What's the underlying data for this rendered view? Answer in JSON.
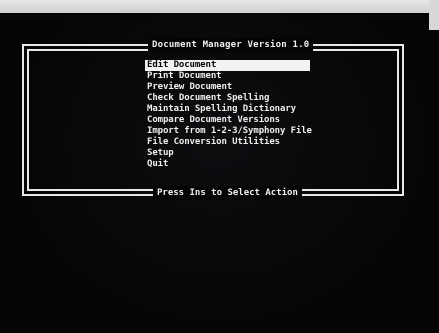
{
  "window": {
    "title": "Document Manager Version 1.0",
    "footer": "Press Ins to Select Action"
  },
  "menu": {
    "selected_index": 0,
    "items": [
      {
        "label": "Edit Document"
      },
      {
        "label": "Print Document"
      },
      {
        "label": "Preview Document"
      },
      {
        "label": "Check Document Spelling"
      },
      {
        "label": "Maintain Spelling Dictionary"
      },
      {
        "label": "Compare Document Versions"
      },
      {
        "label": "Import from 1-2-3/Symphony File"
      },
      {
        "label": "File Conversion Utilities"
      },
      {
        "label": "Setup"
      },
      {
        "label": "Quit"
      }
    ]
  },
  "colors": {
    "background": "#050506",
    "text": "#efefef",
    "highlight": "#f2f2f2"
  }
}
